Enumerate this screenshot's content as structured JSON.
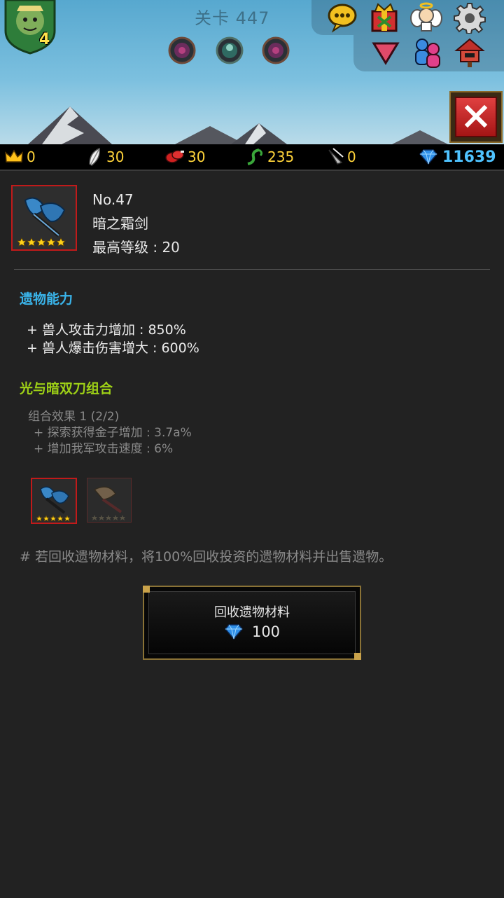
{
  "header": {
    "stage_title": "关卡 447",
    "player_level": "4"
  },
  "top_icons": [
    "chat-icon",
    "gift-box-icon",
    "angel-icon",
    "gear-icon",
    "dropdown-arrow-icon",
    "friends-icon",
    "mailbox-house-icon"
  ],
  "resources": {
    "crown": "0",
    "feather": "30",
    "meat": "30",
    "vine": "235",
    "claw": "0",
    "gems": "11639"
  },
  "relic": {
    "number": "No.47",
    "name": "暗之霜剑",
    "max_level_label": "最高等级 : ",
    "max_level_value": "20",
    "stars": 5
  },
  "abilities": {
    "title": "遗物能力",
    "lines": [
      "+ 兽人攻击力增加 : 850%",
      "+ 兽人爆击伤害增大 : 600%"
    ]
  },
  "combo": {
    "title": "光与暗双刀组合",
    "effect_header": "组合效果 1 (2/2)",
    "effects": [
      "+ 探索获得金子增加 : 3.7a%",
      "+ 增加我军攻击速度 : 6%"
    ]
  },
  "note": "# 若回收遗物材料，将100%回收投资的遗物材料并出售遗物。",
  "recycle_button": {
    "label": "回收遗物材料",
    "cost": "100"
  },
  "colors": {
    "ability_title": "#3ab4ea",
    "combo_title": "#9ed116",
    "resource_value": "#ffd43a",
    "gem_value": "#4fc3ff",
    "frame_red": "#c11a1a"
  }
}
